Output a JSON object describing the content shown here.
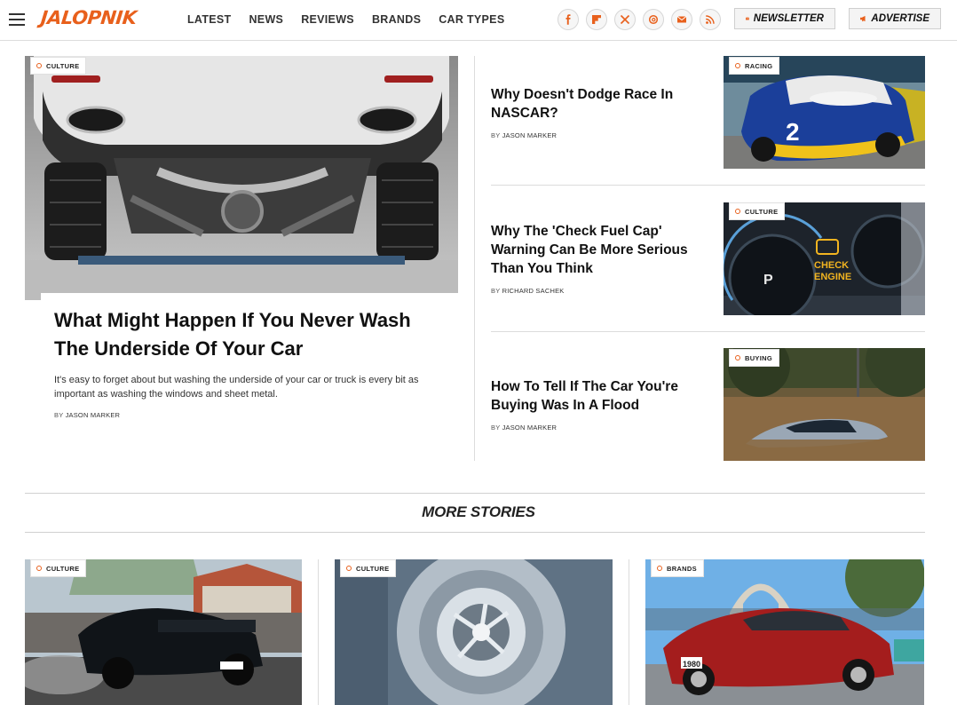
{
  "header": {
    "logo": "JALOPNIK",
    "nav": [
      "LATEST",
      "NEWS",
      "REVIEWS",
      "BRANDS",
      "CAR TYPES"
    ],
    "socials": [
      "facebook-icon",
      "flipboard-icon",
      "x-icon",
      "threads-icon",
      "email-icon",
      "rss-icon"
    ],
    "newsletter_label": "NEWSLETTER",
    "advertise_label": "ADVERTISE"
  },
  "hero": {
    "tag": "CULTURE",
    "title": "What Might Happen If You Never Wash The Underside Of Your Car",
    "description": "It's easy to forget about but washing the underside of your car or truck is every bit as important as washing the windows and sheet metal.",
    "by": "BY",
    "author": "JASON MARKER"
  },
  "side_stories": [
    {
      "tag": "RACING",
      "title": "Why Doesn't Dodge Race In NASCAR?",
      "by": "BY",
      "author": "JASON MARKER"
    },
    {
      "tag": "CULTURE",
      "title": "Why The 'Check Fuel Cap' Warning Can Be More Serious Than You Think",
      "by": "BY",
      "author": "RICHARD SACHEK"
    },
    {
      "tag": "BUYING",
      "title": "How To Tell If The Car You're Buying Was In A Flood",
      "by": "BY",
      "author": "JASON MARKER"
    }
  ],
  "more_stories": {
    "heading": "MORE STORIES",
    "cards": [
      {
        "tag": "CULTURE"
      },
      {
        "tag": "CULTURE"
      },
      {
        "tag": "BRANDS"
      }
    ]
  },
  "image_text": {
    "dash_check": "CHECK",
    "dash_engine": "ENGINE",
    "dash_gear": "P",
    "plate": "1980"
  },
  "colors": {
    "brand": "#e8601c",
    "text": "#111111",
    "divider": "#dcdcdc"
  }
}
